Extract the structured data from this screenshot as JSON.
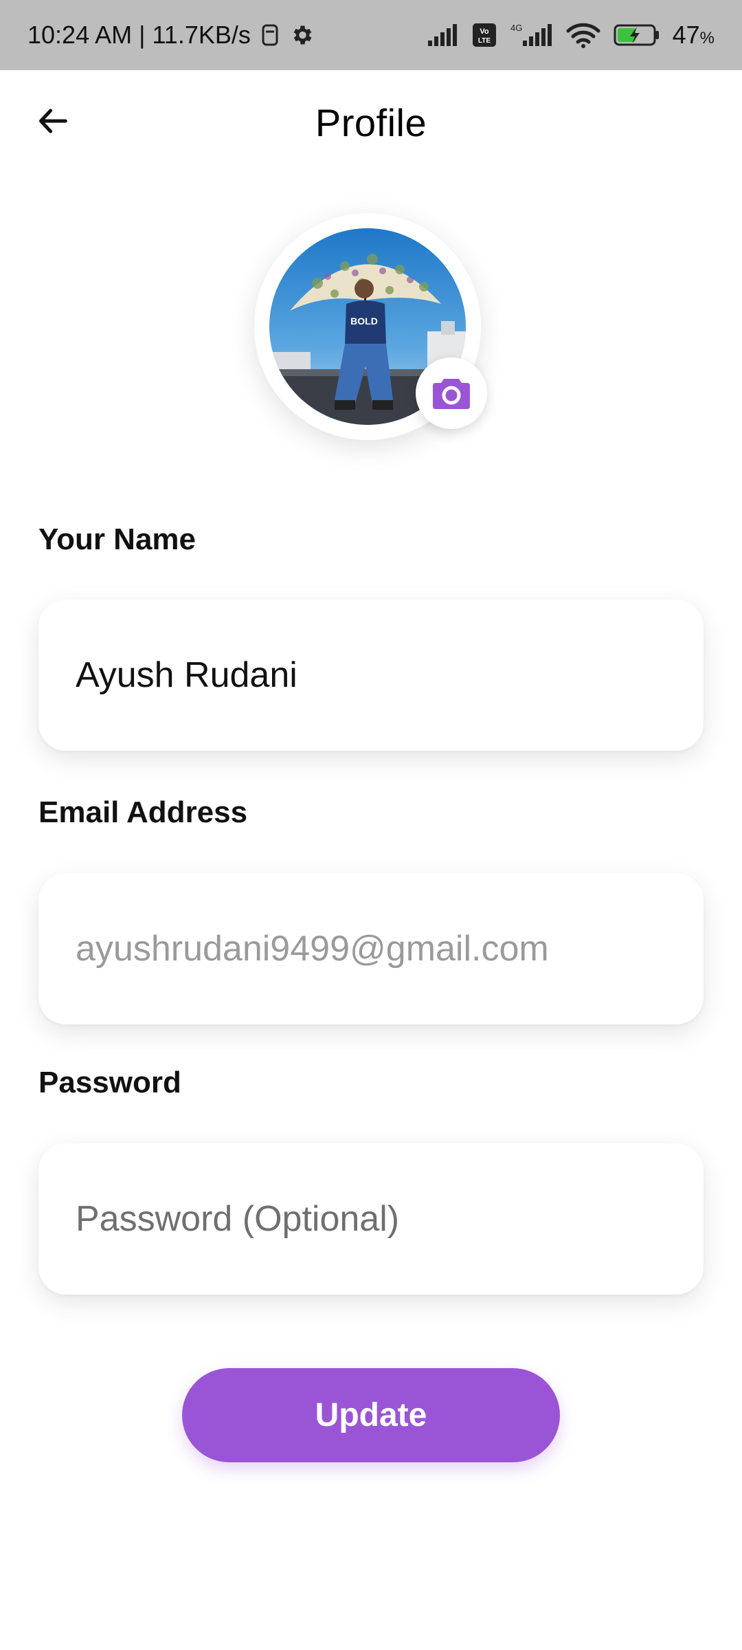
{
  "status_bar": {
    "time_speed": "10:24 AM | 11.7KB/s",
    "battery_percent": "47",
    "battery_unit": "%",
    "network_label": "4G",
    "volte_label": "Vo LTE",
    "icons": [
      "screenshot-icon",
      "gear-icon",
      "signal-icon",
      "volte-icon",
      "signal-4g-icon",
      "wifi-icon",
      "battery-charging-icon"
    ]
  },
  "header": {
    "title": "Profile",
    "back_icon": "arrow-left-icon"
  },
  "profile": {
    "camera_icon": "camera-icon",
    "accent_color": "#9A55D6"
  },
  "form": {
    "name": {
      "label": "Your Name",
      "value": "Ayush Rudani"
    },
    "email": {
      "label": "Email Address",
      "value": "ayushrudani9499@gmail.com"
    },
    "password": {
      "label": "Password",
      "placeholder": "Password (Optional)"
    }
  },
  "actions": {
    "update_label": "Update"
  }
}
